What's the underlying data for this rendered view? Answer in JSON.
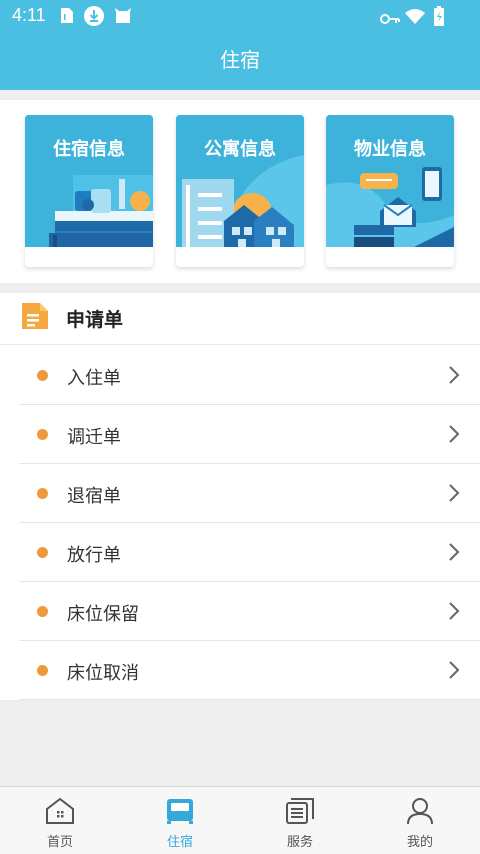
{
  "status_bar": {
    "time": "4:11"
  },
  "header": {
    "title": "住宿"
  },
  "cards": [
    {
      "title": "住宿信息",
      "icon": "bed-illustration"
    },
    {
      "title": "公寓信息",
      "icon": "apartment-illustration"
    },
    {
      "title": "物业信息",
      "icon": "property-illustration"
    }
  ],
  "apply": {
    "title": "申请单",
    "items": [
      {
        "label": "入住单"
      },
      {
        "label": "调迁单"
      },
      {
        "label": "退宿单"
      },
      {
        "label": "放行单"
      },
      {
        "label": "床位保留"
      },
      {
        "label": "床位取消"
      }
    ]
  },
  "tabs": [
    {
      "label": "首页",
      "icon": "home-icon",
      "active": false
    },
    {
      "label": "住宿",
      "icon": "bed-icon",
      "active": true
    },
    {
      "label": "服务",
      "icon": "service-icon",
      "active": false
    },
    {
      "label": "我的",
      "icon": "profile-icon",
      "active": false
    }
  ],
  "colors": {
    "primary": "#4bbfe2",
    "accent_dot": "#f0993a",
    "active_tab": "#35a9d8"
  }
}
